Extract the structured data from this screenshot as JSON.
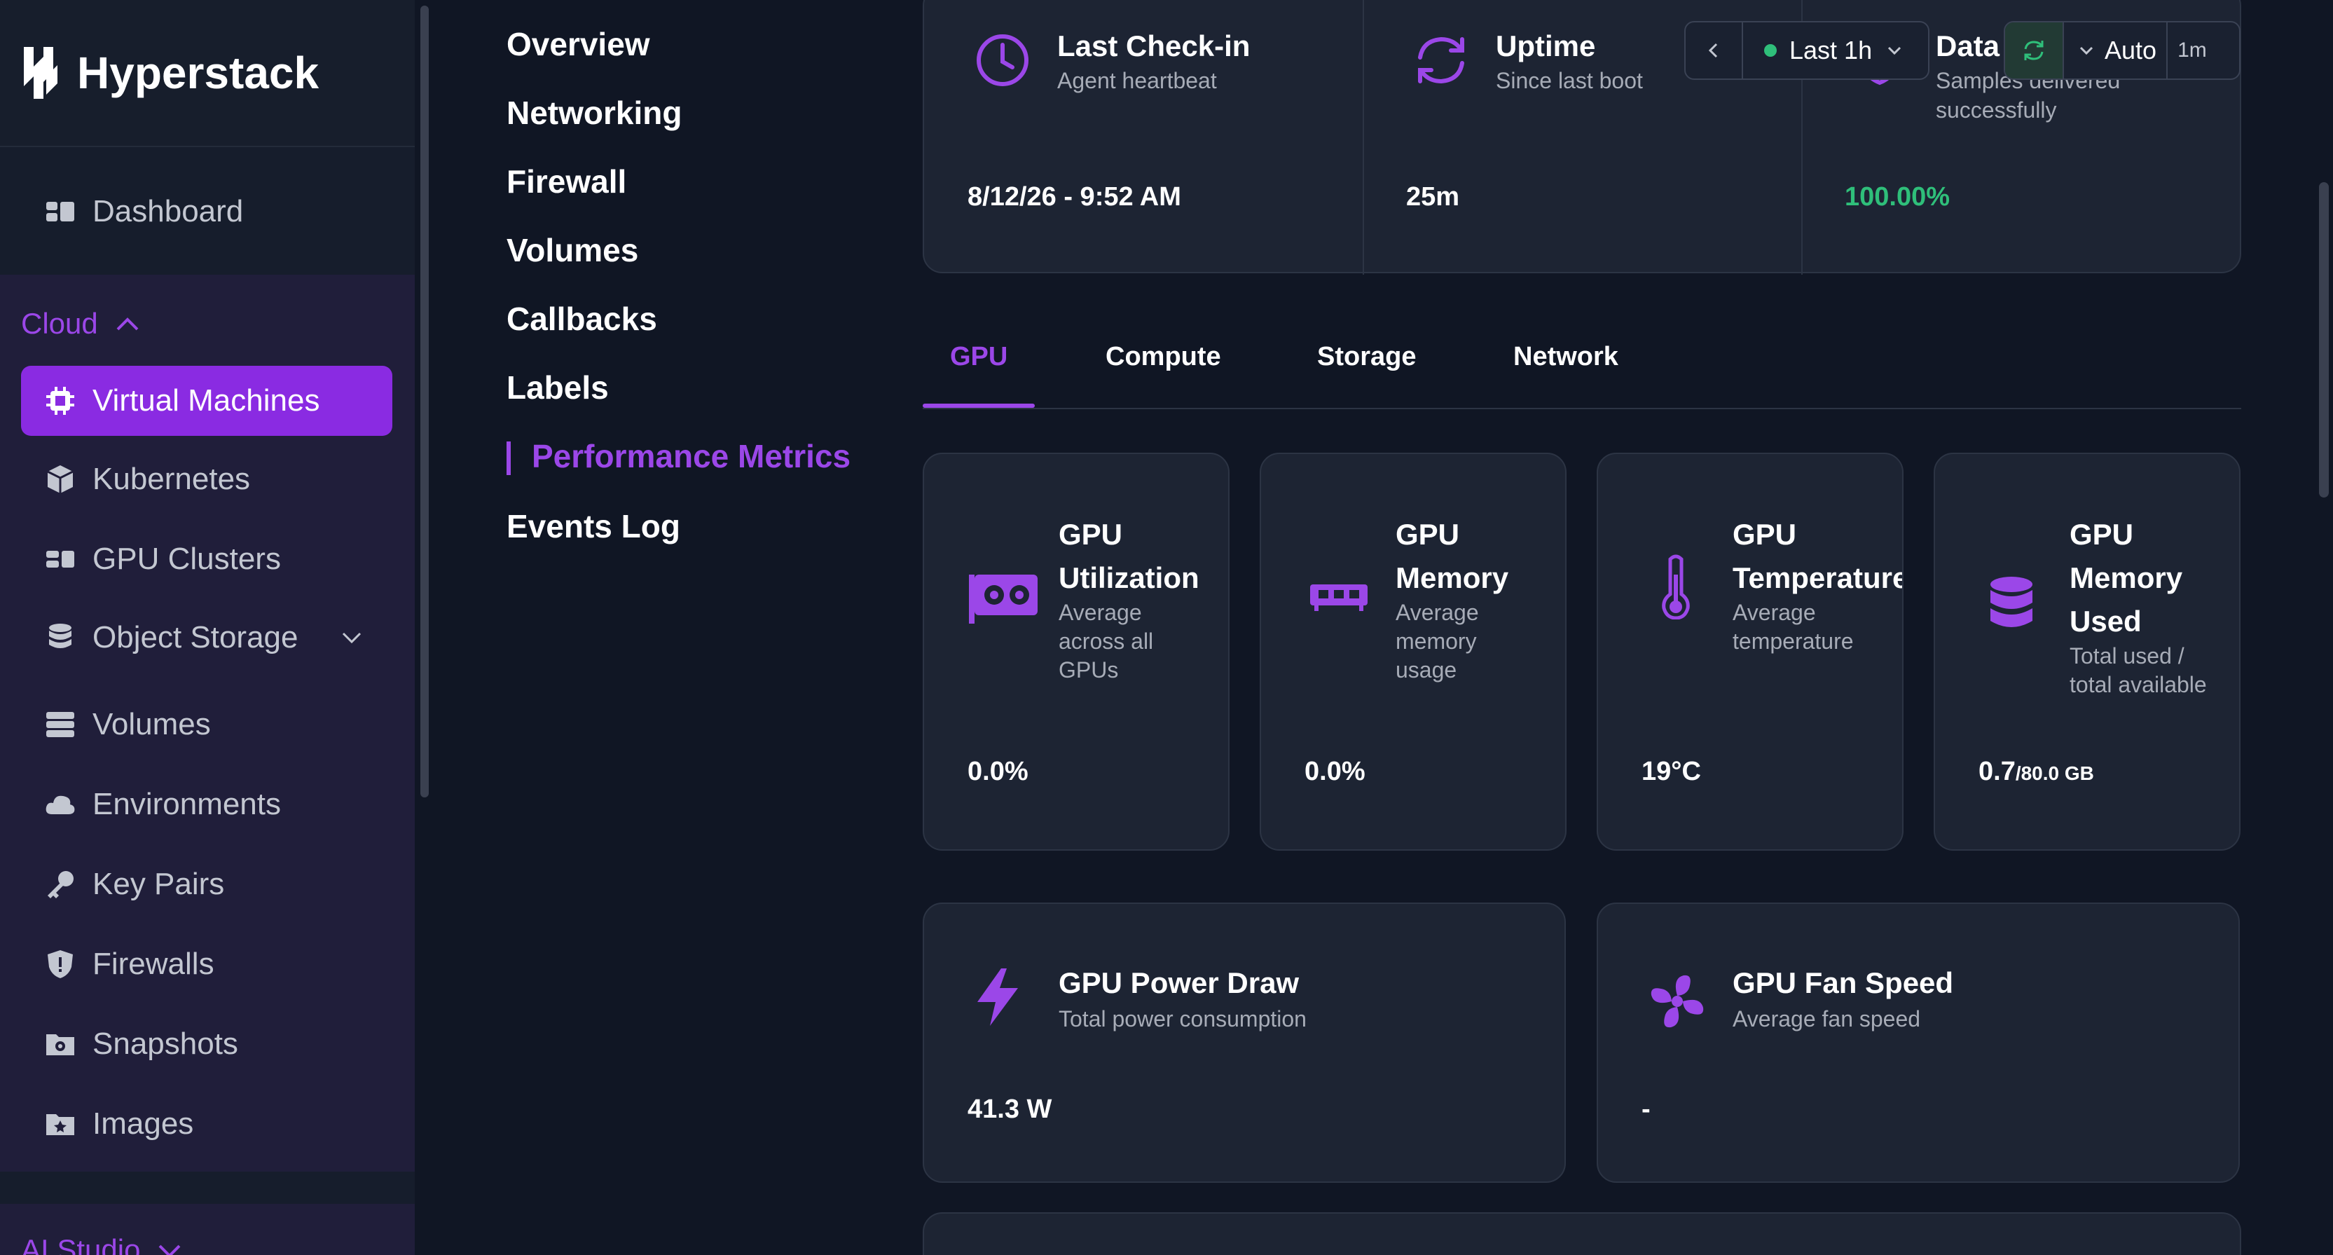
{
  "brand": {
    "name": "Hyperstack"
  },
  "sidebar": {
    "dashboard": {
      "label": "Dashboard",
      "icon": "dashboard-icon"
    },
    "cloud_header": "Cloud",
    "items": [
      {
        "label": "Virtual Machines",
        "icon": "chip-icon",
        "active": true
      },
      {
        "label": "Kubernetes",
        "icon": "cube-icon"
      },
      {
        "label": "GPU Clusters",
        "icon": "clusters-icon"
      },
      {
        "label": "Object Storage",
        "icon": "database-icon",
        "expandable": true
      },
      {
        "label": "Volumes",
        "icon": "volumes-icon"
      },
      {
        "label": "Environments",
        "icon": "cloud-icon"
      },
      {
        "label": "Key Pairs",
        "icon": "key-icon"
      },
      {
        "label": "Firewalls",
        "icon": "shield-icon"
      },
      {
        "label": "Snapshots",
        "icon": "snapshot-icon"
      },
      {
        "label": "Images",
        "icon": "image-icon"
      }
    ],
    "ai_header": "AI Studio"
  },
  "subnav": {
    "items": [
      "Overview",
      "Networking",
      "Firewall",
      "Volumes",
      "Callbacks",
      "Labels",
      "Performance Metrics",
      "Events Log"
    ],
    "active": "Performance Metrics"
  },
  "summary": {
    "checkin": {
      "title": "Last Check-in",
      "subtitle": "Agent heartbeat",
      "value": "8/12/26 - 9:52 AM",
      "icon": "clock-icon"
    },
    "uptime": {
      "title": "Uptime",
      "subtitle": "Since last boot",
      "value": "25m",
      "icon": "refresh-icon"
    },
    "data": {
      "title": "Data",
      "subtitle": "Samples delivered successfully",
      "value": "100.00%",
      "icon": "shield-check-icon"
    }
  },
  "controls": {
    "range": "Last 1h",
    "refresh_mode": "Auto",
    "interval": "1m"
  },
  "tabs": [
    "GPU",
    "Compute",
    "Storage",
    "Network"
  ],
  "active_tab": "GPU",
  "metrics": [
    {
      "title": "GPU\nUtilization",
      "subtitle": "Average\nacross all\nGPUs",
      "value": "0.0%",
      "icon": "gpu-card-icon"
    },
    {
      "title": "GPU\nMemory",
      "subtitle": "Average\nmemory\nusage",
      "value": "0.0%",
      "icon": "memory-icon"
    },
    {
      "title": "GPU\nTemperature",
      "subtitle": "Average\ntemperature",
      "value": "19°C",
      "icon": "thermometer-icon"
    },
    {
      "title": "GPU\nMemory\nUsed",
      "subtitle": "Total used /\ntotal available",
      "value": "0.7",
      "unit": "/80.0 GB",
      "icon": "database-icon"
    },
    {
      "title": "GPU Power Draw",
      "subtitle": "Total power consumption",
      "value": "41.3 W",
      "icon": "lightning-icon"
    },
    {
      "title": "GPU Fan Speed",
      "subtitle": "Average fan speed",
      "value": "-",
      "icon": "fan-icon"
    }
  ],
  "colors": {
    "accent": "#9b47e8",
    "active_bg": "#8a2be2",
    "success": "#2fbf7a",
    "bg": "#101624",
    "card": "#1d2433"
  }
}
